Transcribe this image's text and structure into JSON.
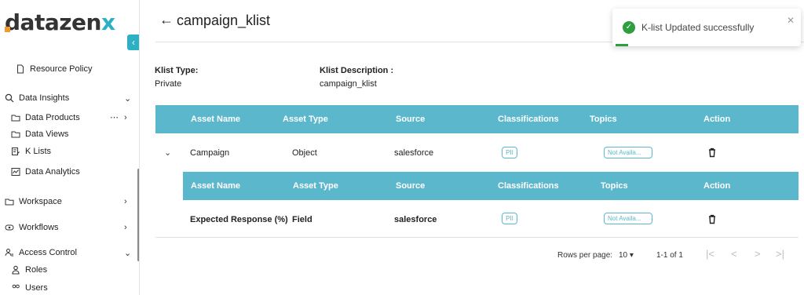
{
  "brand": {
    "logo_main": "datazen",
    "logo_accent": "x"
  },
  "sidebar": {
    "items": [
      {
        "label": "Resource Policy"
      },
      {
        "label": "Data Insights"
      },
      {
        "label": "Data Products",
        "extra": "⋯"
      },
      {
        "label": "Data Views"
      },
      {
        "label": "K Lists"
      },
      {
        "label": "Data Analytics"
      },
      {
        "label": "Workspace"
      },
      {
        "label": "Workflows"
      },
      {
        "label": "Access Control"
      },
      {
        "label": "Roles"
      },
      {
        "label": "Users"
      }
    ]
  },
  "header": {
    "title": "campaign_klist"
  },
  "klist": {
    "type_label": "Klist Type:",
    "type_value": "Private",
    "desc_label": "Klist Description :",
    "desc_value": "campaign_klist"
  },
  "table": {
    "columns": [
      "Asset Name",
      "Asset Type",
      "Source",
      "Classifications",
      "Topics",
      "Action"
    ],
    "rows": [
      {
        "name": "Campaign",
        "type": "Object",
        "source": "salesforce",
        "classification": "PII",
        "topic": "Not Availa..."
      }
    ],
    "sub_columns": [
      "Asset Name",
      "Asset Type",
      "Source",
      "Classifications",
      "Topics",
      "Action"
    ],
    "sub_rows": [
      {
        "name": "Expected Response (%)",
        "type": "Field",
        "source": "salesforce",
        "classification": "PII",
        "topic": "Not Availa..."
      }
    ]
  },
  "pagination": {
    "rows_label": "Rows per page:",
    "rows_value": "10",
    "range": "1-1 of 1"
  },
  "toast": {
    "message": "K-list Updated successfully",
    "color": "#2e9e3e"
  },
  "colors": {
    "accent": "#5bb8cc",
    "brand": "#2cb0c4"
  }
}
